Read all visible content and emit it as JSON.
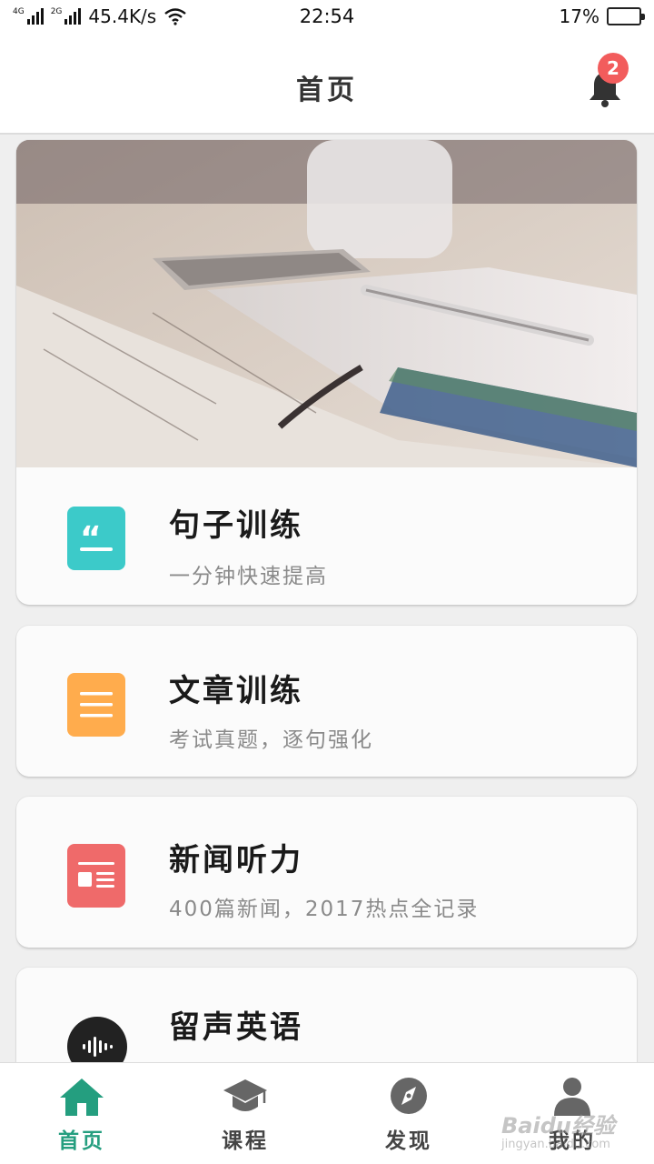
{
  "status_bar": {
    "net1": "4G",
    "net2": "2G",
    "speed": "45.4K/s",
    "time": "22:54",
    "battery": "17%",
    "battery_level": 0.17
  },
  "header": {
    "title": "首页",
    "notification_count": "2"
  },
  "cards": [
    {
      "title": "句子训练",
      "subtitle": "一分钟快速提高",
      "icon": "quote-icon",
      "color": "#3ccac9"
    },
    {
      "title": "文章训练",
      "subtitle": "考试真题，逐句强化",
      "icon": "article-lines-icon",
      "color": "#ffac4d"
    },
    {
      "title": "新闻听力",
      "subtitle": "400篇新闻，2017热点全记录",
      "icon": "news-icon",
      "color": "#ef6a6a"
    },
    {
      "title": "留声英语",
      "subtitle": "",
      "icon": "sound-wave-icon",
      "color": "#222222"
    }
  ],
  "bottom_nav": {
    "items": [
      {
        "label": "首页",
        "icon": "home-icon",
        "active": true
      },
      {
        "label": "课程",
        "icon": "graduation-cap-icon",
        "active": false
      },
      {
        "label": "发现",
        "icon": "compass-icon",
        "active": false
      },
      {
        "label": "我的",
        "icon": "user-icon",
        "active": false
      }
    ],
    "active_color": "#249e7f"
  },
  "watermark": {
    "text": "Baidu经验",
    "url": "jingyan.baidu.com"
  }
}
